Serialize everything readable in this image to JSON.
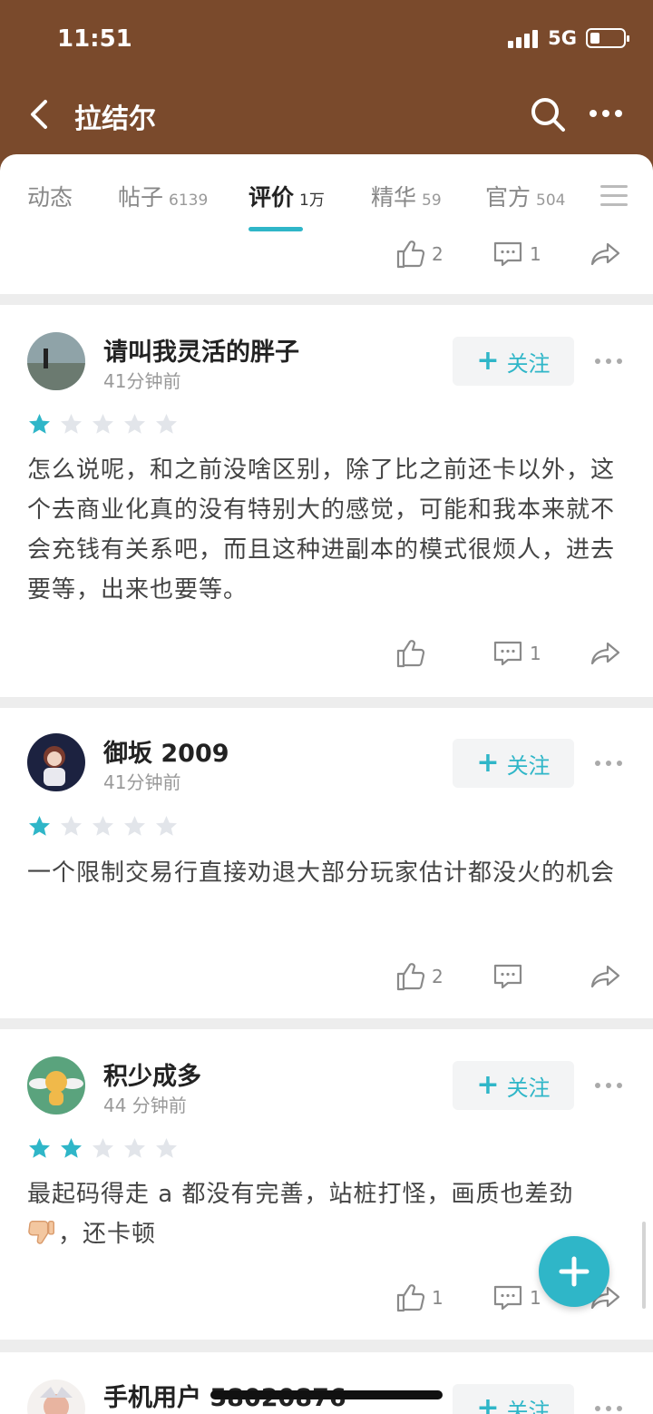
{
  "status": {
    "time": "11:51",
    "network": "5G"
  },
  "header": {
    "title": "拉结尔"
  },
  "tabs": [
    {
      "label": "动态",
      "count": ""
    },
    {
      "label": "帖子",
      "count": "6139"
    },
    {
      "label": "评价",
      "count": "1万"
    },
    {
      "label": "精华",
      "count": "59"
    },
    {
      "label": "官方",
      "count": "504"
    }
  ],
  "colors": {
    "brand": "#7a4a2c",
    "accent": "#2fb6c8",
    "star_off": "#e2e5ea"
  },
  "prev_actions": {
    "likes": "2",
    "comments": "1"
  },
  "reviews": [
    {
      "user": "请叫我灵活的胖子",
      "time": "41分钟前",
      "follow": "关注",
      "rating": 1,
      "text": "怎么说呢，和之前没啥区别，除了比之前还卡以外，这个去商业化真的没有特别大的感觉，可能和我本来就不会充钱有关系吧，而且这种进副本的模式很烦人，进去要等，出来也要等。",
      "likes": "",
      "comments": "1"
    },
    {
      "user": "御坂 2009",
      "time": "41分钟前",
      "follow": "关注",
      "rating": 1,
      "text": "一个限制交易行直接劝退大部分玩家估计都没火的机会",
      "likes": "2",
      "comments": ""
    },
    {
      "user": "积少成多",
      "time": "44 分钟前",
      "follow": "关注",
      "rating": 2,
      "text": "最起码得走 a 都没有完善，站桩打怪，画质也差劲",
      "text_tail": "，还卡顿",
      "likes": "1",
      "comments": "1"
    },
    {
      "user": "手机用户 58020876",
      "follow": "关注"
    }
  ]
}
